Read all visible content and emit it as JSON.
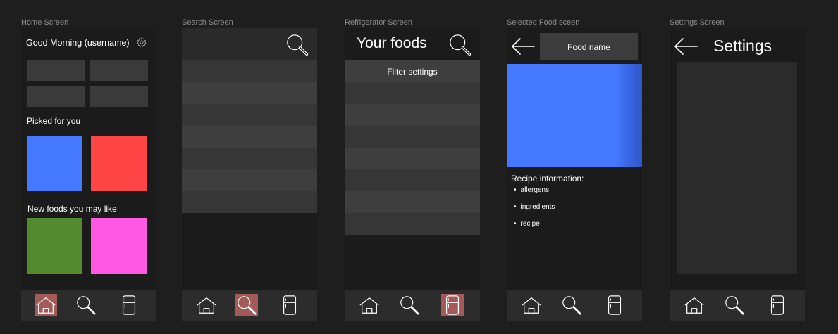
{
  "frames": {
    "home": "Home Screen",
    "search": "Search Screen",
    "fridge": "Refrigerator Screen",
    "food": "Selected Food sceen",
    "settings": "Settings Screen"
  },
  "home": {
    "greeting": "Good Morning (username)",
    "picked_title": "Picked for you",
    "new_title": "New foods you may like",
    "colors": {
      "card1": "#4479ff",
      "card2": "#ff4545",
      "card3": "#548a30",
      "card4": "#ff59e3"
    }
  },
  "fridge": {
    "title": "Your foods",
    "filter_label": "Filter settings"
  },
  "food": {
    "name_label": "Food name",
    "recipe_title": "Recipe information:",
    "items": [
      "allergens",
      "ingredients",
      "recipe"
    ],
    "colors": {
      "image": "#4479ff"
    }
  },
  "settings": {
    "title": "Settings"
  },
  "nav": {
    "icons": [
      "house-icon",
      "search-icon",
      "fridge-icon"
    ],
    "active_color": "#a25b58"
  }
}
